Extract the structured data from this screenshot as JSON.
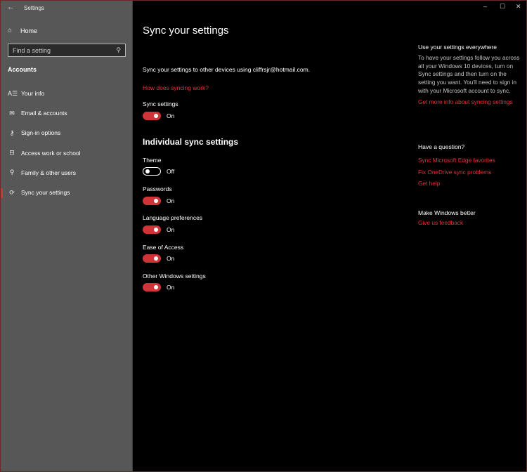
{
  "window": {
    "app_title": "Settings",
    "controls": {
      "minimize": "–",
      "maximize": "☐",
      "close": "✕"
    }
  },
  "sidebar": {
    "home_label": "Home",
    "search": {
      "placeholder": "Find a setting",
      "value": ""
    },
    "section_title": "Accounts",
    "items": [
      {
        "label": "Your info",
        "icon": "person-card-icon",
        "glyph": "A☰",
        "active": false
      },
      {
        "label": "Email & accounts",
        "icon": "mail-icon",
        "glyph": "✉",
        "active": false
      },
      {
        "label": "Sign-in options",
        "icon": "key-icon",
        "glyph": "⚷",
        "active": false
      },
      {
        "label": "Access work or school",
        "icon": "briefcase-icon",
        "glyph": "⊟",
        "active": false
      },
      {
        "label": "Family & other users",
        "icon": "add-person-icon",
        "glyph": "⚲",
        "active": false
      },
      {
        "label": "Sync your settings",
        "icon": "sync-icon",
        "glyph": "⟳",
        "active": true
      }
    ]
  },
  "main": {
    "title": "Sync your settings",
    "description": "Sync your settings to other devices using cliffrsjr@hotmail.com.",
    "how_link": "How does syncing work?",
    "sync_settings": {
      "label": "Sync settings",
      "state": "On",
      "on": true
    },
    "individual_heading": "Individual sync settings",
    "individual": [
      {
        "label": "Theme",
        "state": "Off",
        "on": false
      },
      {
        "label": "Passwords",
        "state": "On",
        "on": true
      },
      {
        "label": "Language preferences",
        "state": "On",
        "on": true
      },
      {
        "label": "Ease of Access",
        "state": "On",
        "on": true
      },
      {
        "label": "Other Windows settings",
        "state": "On",
        "on": true
      }
    ]
  },
  "right_panel": {
    "everywhere": {
      "heading": "Use your settings everywhere",
      "text": "To have your settings follow you across all your Windows 10 devices, turn on Sync settings and then turn on the setting you want. You'll need to sign in with your Microsoft account to sync.",
      "link": "Get more info about syncing settings"
    },
    "question": {
      "heading": "Have a question?",
      "links": [
        "Sync Microsoft Edge favorites",
        "Fix OneDrive sync problems",
        "Get help"
      ]
    },
    "better": {
      "heading": "Make Windows better",
      "link": "Give us feedback"
    }
  },
  "colors": {
    "accent": "#d13438",
    "link": "#e8323a",
    "sidebar_bg": "#575757",
    "main_bg": "#000000"
  }
}
